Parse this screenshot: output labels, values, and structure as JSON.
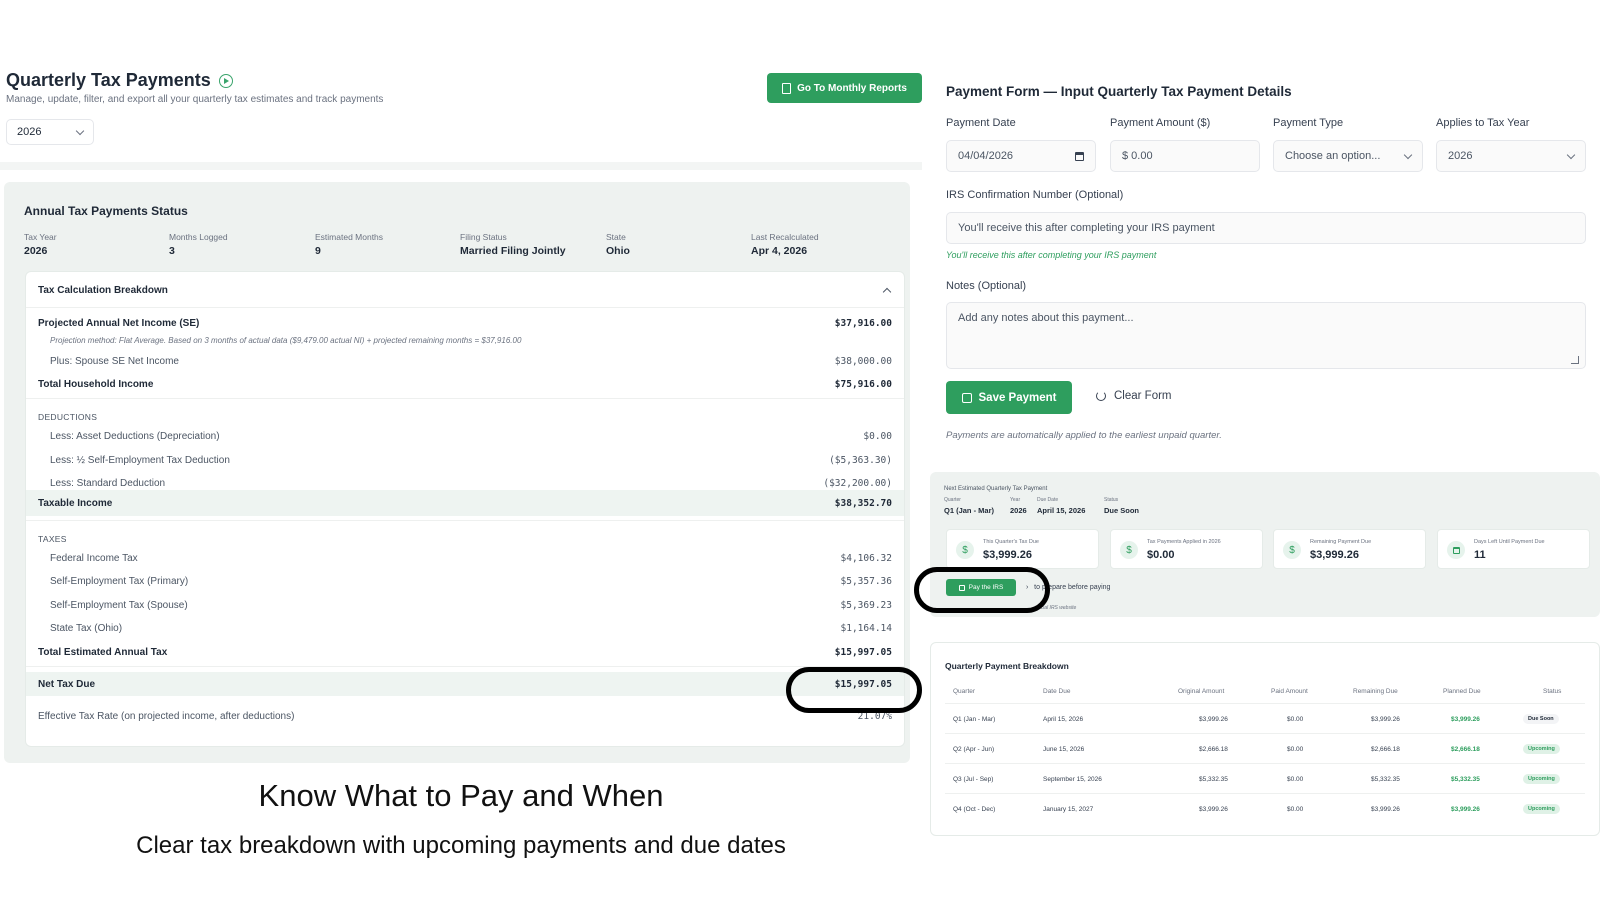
{
  "header": {
    "title": "Quarterly Tax Payments",
    "subtitle": "Manage, update, filter, and export all your quarterly tax estimates and track payments",
    "year": "2026",
    "monthly_button": "Go To Monthly Reports"
  },
  "annual": {
    "title": "Annual Tax Payments Status",
    "meta": [
      {
        "k": "Tax Year",
        "v": "2026"
      },
      {
        "k": "Months Logged",
        "v": "3"
      },
      {
        "k": "Estimated Months",
        "v": "9"
      },
      {
        "k": "Filing Status",
        "v": "Married Filing Jointly"
      },
      {
        "k": "State",
        "v": "Ohio"
      },
      {
        "k": "Last Recalculated",
        "v": "Apr 4, 2026"
      }
    ],
    "breakdown_title": "Tax Calculation Breakdown",
    "projected_label": "Projected Annual Net Income (SE)",
    "projected_amt": "$37,916.00",
    "projection_note": "Projection method: Flat Average. Based on 3 months of actual data ($9,479.00 actual NI) + projected remaining months = $37,916.00",
    "spouse_label": "Plus: Spouse SE Net Income",
    "spouse_amt": "$38,000.00",
    "household_label": "Total Household Income",
    "household_amt": "$75,916.00",
    "deductions_header": "DEDUCTIONS",
    "deductions": [
      {
        "label": "Less: Asset Deductions (Depreciation)",
        "amt": "$0.00"
      },
      {
        "label": "Less: ½ Self-Employment Tax Deduction",
        "amt": "($5,363.30)"
      },
      {
        "label": "Less: Standard Deduction",
        "amt": "($32,200.00)"
      }
    ],
    "taxable_label": "Taxable Income",
    "taxable_amt": "$38,352.70",
    "taxes_header": "TAXES",
    "taxes": [
      {
        "label": "Federal Income Tax",
        "amt": "$4,106.32"
      },
      {
        "label": "Self-Employment Tax (Primary)",
        "amt": "$5,357.36"
      },
      {
        "label": "Self-Employment Tax (Spouse)",
        "amt": "$5,369.23"
      },
      {
        "label": "State Tax (Ohio)",
        "amt": "$1,164.14"
      }
    ],
    "total_tax_label": "Total Estimated Annual Tax",
    "total_tax_amt": "$15,997.05",
    "net_due_label": "Net Tax Due",
    "net_due_amt": "$15,997.05",
    "eff_rate_label": "Effective Tax Rate (on projected income, after deductions)",
    "eff_rate_amt": "21.07%"
  },
  "hero": {
    "title": "Know What to Pay and When",
    "subtitle": "Clear tax breakdown with upcoming payments and due dates"
  },
  "form": {
    "title": "Payment Form — Input Quarterly Tax Payment Details",
    "date_label": "Payment Date",
    "date_value": "04/04/2026",
    "amount_label": "Payment Amount ($)",
    "amount_value": "$  0.00",
    "type_label": "Payment Type",
    "type_value": "Choose an option...",
    "year_label": "Applies to Tax Year",
    "year_value": "2026",
    "irs_label": "IRS Confirmation Number (Optional)",
    "irs_placeholder": "You'll receive this after completing your IRS payment",
    "irs_helper": "You'll receive this after completing your IRS payment",
    "notes_label": "Notes (Optional)",
    "notes_placeholder": "Add any notes about this payment...",
    "save_label": "Save Payment",
    "clear_label": "Clear Form",
    "auto_note": "Payments are automatically applied to the earliest unpaid quarter."
  },
  "next": {
    "title": "Next Estimated Quarterly Tax Payment",
    "meta": [
      {
        "k": "Quarter",
        "v": "Q1 (Jan - Mar)"
      },
      {
        "k": "Year",
        "v": "2026"
      },
      {
        "k": "Due Date",
        "v": "April 15, 2026"
      },
      {
        "k": "Status",
        "v": "Due Soon"
      }
    ],
    "stats": [
      {
        "k": "This Quarter's Tax Due",
        "v": "$3,999.26",
        "icon": "$"
      },
      {
        "k": "Tax Payments Applied in 2026",
        "v": "$0.00",
        "icon": "$"
      },
      {
        "k": "Remaining Payment Due",
        "v": "$3,999.26",
        "icon": "$"
      },
      {
        "k": "Days Left Until Payment Due",
        "v": "11",
        "icon": "calendar"
      }
    ],
    "pay_label": "Pay the IRS",
    "prep_text": "to prepare before paying",
    "irs_site": "official IRS website"
  },
  "quarterly": {
    "title": "Quarterly Payment Breakdown",
    "columns": [
      "Quarter",
      "Date Due",
      "Original Amount",
      "Paid Amount",
      "Remaining Due",
      "Planned Due",
      "Status"
    ],
    "rows": [
      {
        "q": "Q1 (Jan - Mar)",
        "due": "April 15, 2026",
        "orig": "$3,999.26",
        "paid": "$0.00",
        "rem": "$3,999.26",
        "plan": "$3,999.26",
        "status": "Due Soon"
      },
      {
        "q": "Q2 (Apr - Jun)",
        "due": "June 15, 2026",
        "orig": "$2,666.18",
        "paid": "$0.00",
        "rem": "$2,666.18",
        "plan": "$2,666.18",
        "status": "Upcoming"
      },
      {
        "q": "Q3 (Jul - Sep)",
        "due": "September 15, 2026",
        "orig": "$5,332.35",
        "paid": "$0.00",
        "rem": "$5,332.35",
        "plan": "$5,332.35",
        "status": "Upcoming"
      },
      {
        "q": "Q4 (Oct - Dec)",
        "due": "January 15, 2027",
        "orig": "$3,999.26",
        "paid": "$0.00",
        "rem": "$3,999.26",
        "plan": "$3,999.26",
        "status": "Upcoming"
      }
    ]
  },
  "colors": {
    "accent": "#2e9e5e",
    "panel": "#eef2f0"
  }
}
